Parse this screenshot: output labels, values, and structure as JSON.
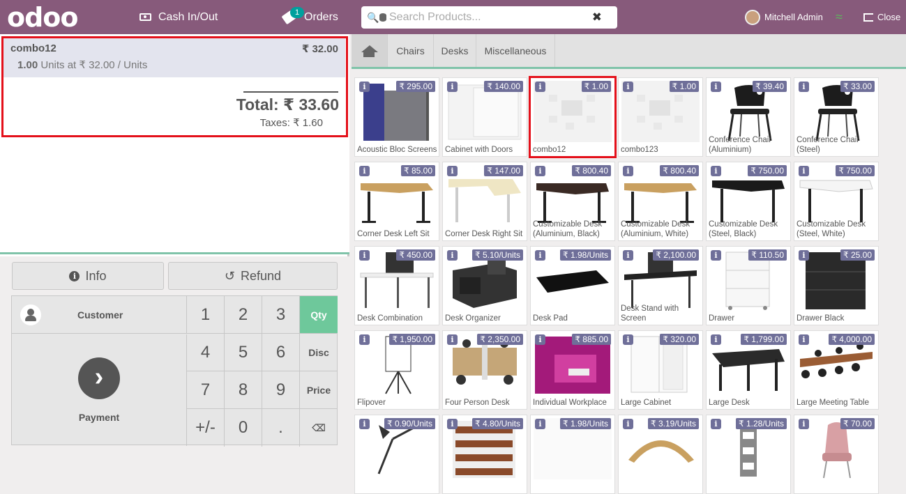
{
  "header": {
    "logo": "odoo",
    "cash_label": "Cash In/Out",
    "orders_label": "Orders",
    "orders_count": "1",
    "search_placeholder": "Search Products...",
    "user_name": "Mitchell Admin",
    "close_label": "Close"
  },
  "order": {
    "line": {
      "name": "combo12",
      "price": "₹ 32.00",
      "qty": "1.00",
      "unit_text": "Units at ₹ 32.00 / Units"
    },
    "total": "Total: ₹ 33.60",
    "taxes": "Taxes: ₹ 1.60"
  },
  "controls": {
    "info_label": "Info",
    "refund_label": "Refund",
    "customer_label": "Customer",
    "payment_label": "Payment",
    "keys": [
      "1",
      "2",
      "3",
      "Qty",
      "4",
      "5",
      "6",
      "Disc",
      "7",
      "8",
      "9",
      "Price",
      "+/-",
      "0",
      ".",
      "⌫"
    ]
  },
  "categories": [
    "Chairs",
    "Desks",
    "Miscellaneous"
  ],
  "products": [
    {
      "name": "Acoustic Bloc Screens",
      "price": "₹ 295.00",
      "img": "screen"
    },
    {
      "name": "Cabinet with Doors",
      "price": "₹ 140.00",
      "img": "cabinet-white"
    },
    {
      "name": "combo12",
      "price": "₹ 1.00",
      "img": "placeholder"
    },
    {
      "name": "combo123",
      "price": "₹ 1.00",
      "img": "placeholder"
    },
    {
      "name": "Conference Chair (Aluminium)",
      "price": "₹ 39.40",
      "img": "chair"
    },
    {
      "name": "Conference Chair (Steel)",
      "price": "₹ 33.00",
      "img": "chair"
    },
    {
      "name": "Corner Desk Left Sit",
      "price": "₹ 85.00",
      "img": "desk-wood"
    },
    {
      "name": "Corner Desk Right Sit",
      "price": "₹ 147.00",
      "img": "desk-light"
    },
    {
      "name": "Customizable Desk (Aluminium, Black)",
      "price": "₹ 800.40",
      "img": "desk-dark"
    },
    {
      "name": "Customizable Desk (Aluminium, White)",
      "price": "₹ 800.40",
      "img": "desk-wood"
    },
    {
      "name": "Customizable Desk (Steel, Black)",
      "price": "₹ 750.00",
      "img": "desk-black"
    },
    {
      "name": "Customizable Desk (Steel, White)",
      "price": "₹ 750.00",
      "img": "desk-white"
    },
    {
      "name": "Desk Combination",
      "price": "₹ 450.00",
      "img": "desk-combo"
    },
    {
      "name": "Desk Organizer",
      "price": "₹ 5.10/Units",
      "img": "organizer"
    },
    {
      "name": "Desk Pad",
      "price": "₹ 1.98/Units",
      "img": "deskpad"
    },
    {
      "name": "Desk Stand with Screen",
      "price": "₹ 2,100.00",
      "img": "desk-stand"
    },
    {
      "name": "Drawer",
      "price": "₹ 110.50",
      "img": "drawer-white"
    },
    {
      "name": "Drawer Black",
      "price": "₹ 25.00",
      "img": "drawer-black"
    },
    {
      "name": "Flipover",
      "price": "₹ 1,950.00",
      "img": "flipover"
    },
    {
      "name": "Four Person Desk",
      "price": "₹ 2,350.00",
      "img": "four-desk"
    },
    {
      "name": "Individual Workplace",
      "price": "₹ 885.00",
      "img": "workplace"
    },
    {
      "name": "Large Cabinet",
      "price": "₹ 320.00",
      "img": "large-cabinet"
    },
    {
      "name": "Large Desk",
      "price": "₹ 1,799.00",
      "img": "large-desk"
    },
    {
      "name": "Large Meeting Table",
      "price": "₹ 4,000.00",
      "img": "meeting-table"
    },
    {
      "name": "",
      "price": "₹ 0.90/Units",
      "img": "lamp"
    },
    {
      "name": "",
      "price": "₹ 4.80/Units",
      "img": "shelf"
    },
    {
      "name": "",
      "price": "₹ 1.98/Units",
      "img": "blank"
    },
    {
      "name": "",
      "price": "₹ 3.19/Units",
      "img": "stand-wood"
    },
    {
      "name": "",
      "price": "₹ 1.28/Units",
      "img": "stacks"
    },
    {
      "name": "",
      "price": "₹ 70.00",
      "img": "pink-chair"
    }
  ],
  "selected_product_index": 2,
  "colors": {
    "brand": "#875a7b",
    "accent": "#6ec89b",
    "price_badge": "#6f6f99",
    "highlight": "#e4101a"
  }
}
